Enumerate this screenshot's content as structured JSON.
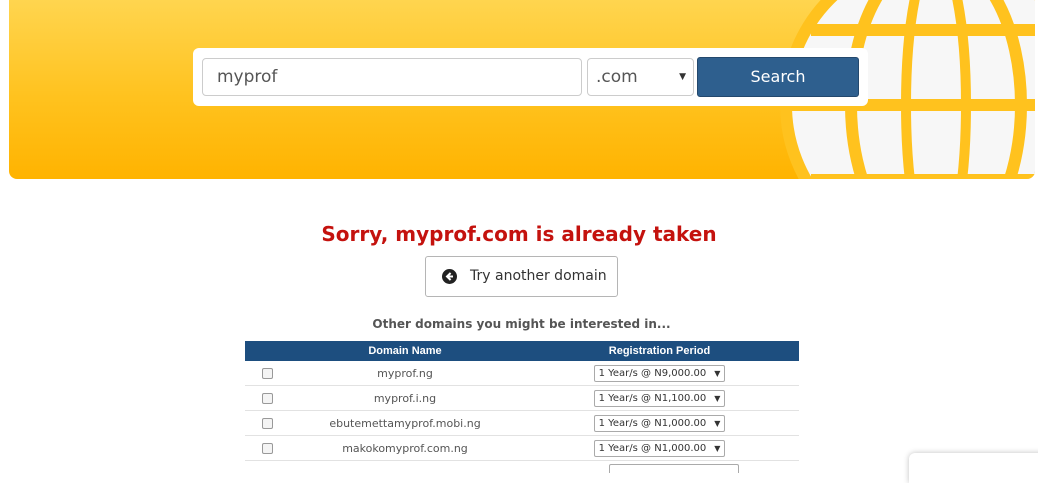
{
  "search": {
    "query_value": "myprof",
    "tld_value": ".com",
    "button_label": "Search"
  },
  "result": {
    "message": "Sorry, myprof.com is already taken",
    "try_another_label": "Try another domain",
    "suggestions_heading": "Other domains you might be interested in..."
  },
  "table": {
    "headers": [
      "",
      "Domain Name",
      "Registration Period"
    ],
    "rows": [
      {
        "domain": "myprof.ng",
        "period": "1 Year/s @ N9,000.00"
      },
      {
        "domain": "myprof.i.ng",
        "period": "1 Year/s @ N1,100.00"
      },
      {
        "domain": "ebutemettamyprof.mobi.ng",
        "period": "1 Year/s @ N1,000.00"
      },
      {
        "domain": "makokomyprof.com.ng",
        "period": "1 Year/s @ N1,000.00"
      }
    ]
  },
  "icons": {
    "globe": "globe-icon",
    "try_another": "circle-arrow-left-icon",
    "select_arrow": "caret-down-icon"
  },
  "colors": {
    "hero_yellow": "#ffc21e",
    "search_button": "#2e5f8e",
    "taken_red": "#c4120e",
    "table_header": "#1d4e7f"
  }
}
